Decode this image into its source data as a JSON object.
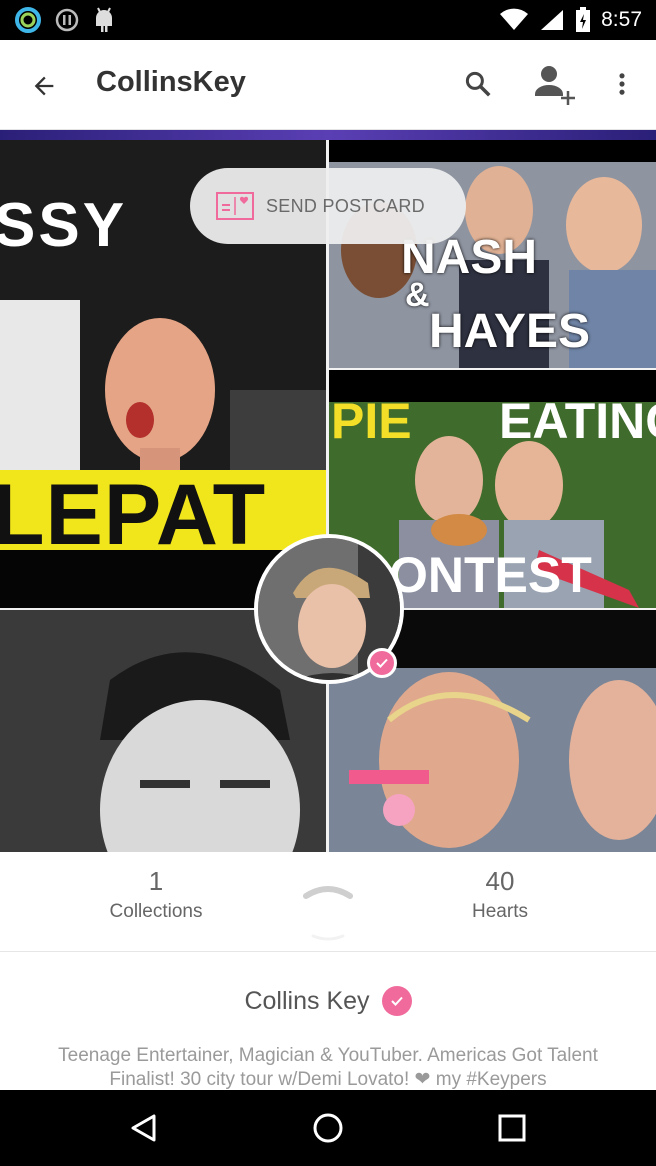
{
  "status_bar": {
    "time": "8:57"
  },
  "app_bar": {
    "title": "CollinsKey",
    "icons": [
      "back-arrow-icon",
      "search-icon",
      "add-person-icon",
      "more-vert-icon"
    ]
  },
  "cover": {
    "tiles": [
      {
        "text_top": "SSY",
        "text_bottom": "LEPAT"
      },
      {
        "text_top": "NASH",
        "text_mid": "&",
        "text_bottom": "HAYES"
      },
      {
        "text_top": "PIE",
        "text_top_right": "EATING",
        "text_bottom": "ONTEST"
      },
      {},
      {}
    ],
    "postcard": {
      "label": "SEND POSTCARD",
      "icon": "postcard-icon"
    }
  },
  "stats": {
    "collections": {
      "value": "1",
      "label": "Collections"
    },
    "hearts": {
      "value": "40",
      "label": "Hearts"
    }
  },
  "profile": {
    "name": "Collins Key",
    "bio": "Teenage Entertainer, Magician & YouTuber. Americas Got Talent Finalist! 30 city tour w/Demi Lovato! ❤ my #Keypers"
  },
  "colors": {
    "accent": "#f06b9b",
    "status_bar": "#000000",
    "nav_bar": "#000000"
  }
}
